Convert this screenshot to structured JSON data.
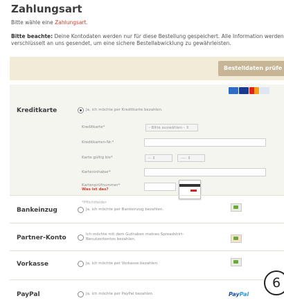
{
  "page": {
    "title": "Zahlungsart",
    "subtitle_prefix": "Bitte wähle eine ",
    "subtitle_accent": "Zahlungsart.",
    "note_bold": "Bitte beachte:",
    "note_text": " Deine Kontodaten werden nur für diese Bestellung gespeichert. Alle Information werden verschlüsselt an uns gesendet, um eine sichere Bestellabwicklung zu gewährleisten.",
    "check_button": "Bestelldaten prüfe"
  },
  "methods": {
    "kreditkarte": {
      "label": "Kreditkarte",
      "option": "Ja, ich möchte per Kreditkarte bezahlen.",
      "selected": true,
      "fields": {
        "kreditkarte": "Kreditkarte*",
        "kreditkarte_select": "- Bitte auswählen - ⇕",
        "nummer": "Kreditkarten-Nr.*",
        "gueltig": "Karte gültig bis*",
        "month_select": "--   ⇕",
        "year_select": "----   ⇕",
        "inhaber": "Karteninhaber*",
        "pruefnummer": "Kartenprüfnummer*",
        "was_ist_das": "Was ist das?",
        "pflicht": "*Pflichtfelder"
      }
    },
    "bankeinzug": {
      "label": "Bankeinzug",
      "option": "Ja, ich möchte per Bankeinzug bezahlen.",
      "selected": false
    },
    "partner": {
      "label": "Partner-Konto",
      "option_line1": "Ich möchte mit dem Guthaben meines Spreadshirt-",
      "option_line2": "Benutzerkontos bezahlen.",
      "selected": false
    },
    "vorkasse": {
      "label": "Vorkasse",
      "option": "Ja, ich möchte per Vorkasse bezahlen.",
      "selected": false
    },
    "paypal": {
      "label": "PayPal",
      "option": "Ja, ich möchte per PayPal bezahlen.",
      "selected": false,
      "logo_a": "Pay",
      "logo_b": "Pal"
    }
  },
  "colors": {
    "accent": "#d23c2a",
    "button": "#c7b596",
    "panel": "#f5f5ef"
  },
  "callout": "6"
}
